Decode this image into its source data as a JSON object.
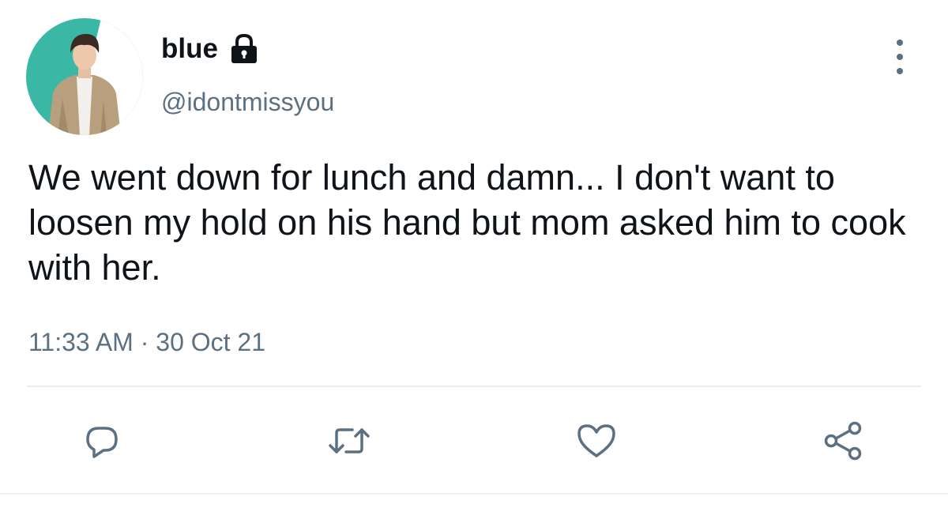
{
  "tweet": {
    "display_name": "blue",
    "handle": "@idontmissyou",
    "text": "We went down for lunch and damn... I don't want to loosen my hold on his hand but mom asked him to cook with her.",
    "time": "11:33 AM",
    "date": "30 Oct 21",
    "separator": " · "
  },
  "icons": {
    "lock": "lock-icon",
    "more": "more-vertical-icon",
    "reply": "reply-icon",
    "retweet": "retweet-icon",
    "like": "heart-icon",
    "share": "share-icon"
  },
  "colors": {
    "text": "#0f1419",
    "secondary": "#5b7083",
    "avatar_bg": "#3bb7a5",
    "divider": "#e6ecf0"
  }
}
